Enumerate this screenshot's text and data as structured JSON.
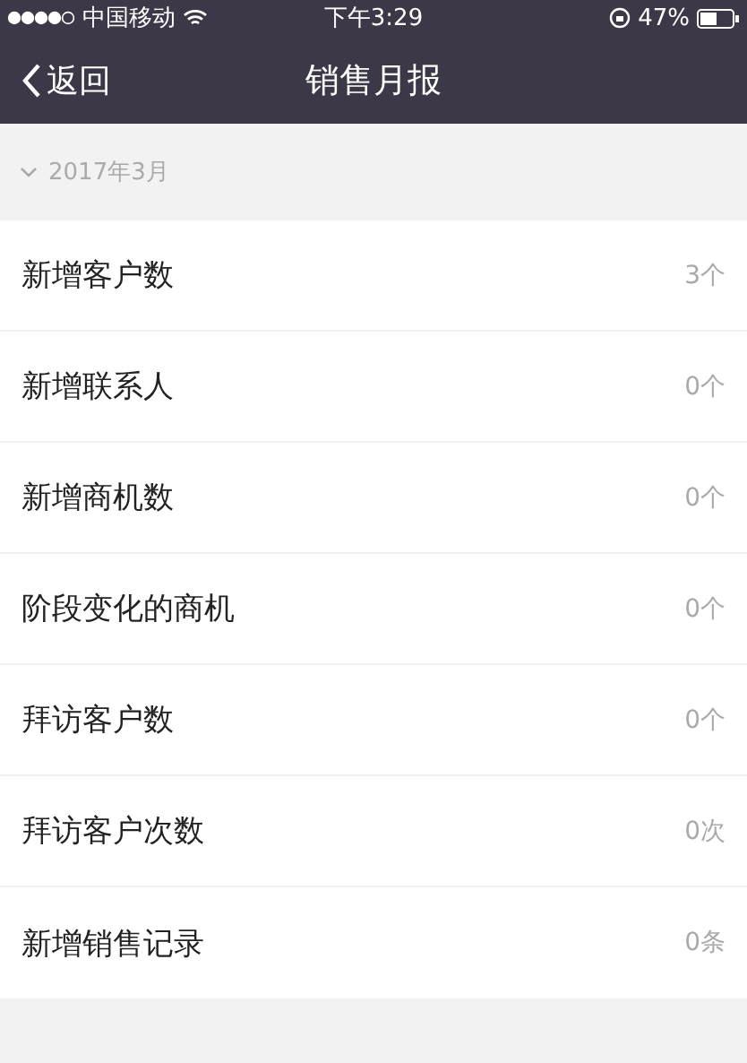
{
  "status_bar": {
    "carrier": "中国移动",
    "time": "下午3:29",
    "battery": "47%"
  },
  "nav": {
    "back": "返回",
    "title": "销售月报"
  },
  "section": {
    "label": "2017年3月",
    "expanded": true
  },
  "rows": [
    {
      "label": "新增客户数",
      "value": "3个"
    },
    {
      "label": "新增联系人",
      "value": "0个"
    },
    {
      "label": "新增商机数",
      "value": "0个"
    },
    {
      "label": "阶段变化的商机",
      "value": "0个"
    },
    {
      "label": "拜访客户数",
      "value": "0个"
    },
    {
      "label": "拜访客户次数",
      "value": "0次"
    },
    {
      "label": "新增销售记录",
      "value": "0条"
    }
  ]
}
